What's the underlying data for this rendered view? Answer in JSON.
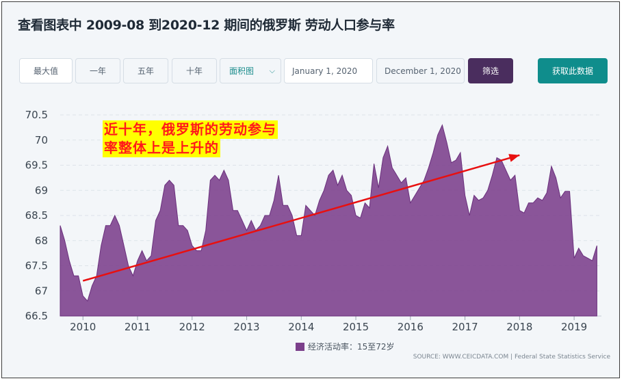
{
  "title": "查看图表中 2009-08 到2020-12 期间的俄罗斯 劳动人口参与率",
  "controls": {
    "max_label": "最大值",
    "one_year_label": "一年",
    "five_year_label": "五年",
    "ten_year_label": "十年",
    "chart_type_value": "面积图",
    "start_date": "January 1, 2020",
    "end_date": "December 1, 2020",
    "filter_label": "筛选",
    "get_data_label": "获取此数据"
  },
  "annotation": {
    "line1": "近十年，俄罗斯的劳动参与",
    "line2": "率整体上是上升的"
  },
  "source": "SOURCE: WWW.CEICDATA.COM | Federal State Statistics Service",
  "colors": {
    "area": "#7b3f8b",
    "trend": "#e81010",
    "filter_button": "#4a2d5e",
    "get_data_button": "#0f8d8c"
  },
  "chart_data": {
    "type": "area",
    "x_start": "2009-08",
    "x_end": "2019-07",
    "series": [
      {
        "name": "经济活动率：15至72岁",
        "values": [
          68.3,
          68.0,
          67.6,
          67.3,
          67.3,
          66.9,
          66.8,
          67.1,
          67.3,
          67.9,
          68.3,
          68.3,
          68.5,
          68.3,
          67.9,
          67.5,
          67.3,
          67.6,
          67.8,
          67.6,
          67.7,
          68.4,
          68.6,
          69.1,
          69.2,
          69.1,
          68.3,
          68.3,
          68.2,
          67.9,
          67.8,
          67.8,
          68.2,
          69.2,
          69.3,
          69.2,
          69.4,
          69.2,
          68.6,
          68.6,
          68.4,
          68.2,
          68.4,
          68.2,
          68.3,
          68.5,
          68.5,
          68.8,
          69.3,
          68.7,
          68.7,
          68.5,
          68.1,
          68.1,
          68.7,
          68.6,
          68.5,
          68.8,
          69.0,
          69.3,
          69.4,
          69.1,
          69.3,
          69.0,
          68.9,
          68.5,
          68.45,
          68.75,
          68.65,
          69.53,
          69.05,
          69.65,
          69.88,
          69.45,
          69.3,
          69.15,
          69.25,
          68.75,
          68.9,
          69.05,
          69.2,
          69.45,
          69.75,
          70.1,
          70.3,
          69.95,
          69.55,
          69.6,
          69.75,
          68.9,
          68.5,
          68.9,
          68.8,
          68.85,
          69.0,
          69.3,
          69.65,
          69.6,
          69.4,
          69.2,
          69.3,
          68.6,
          68.55,
          68.75,
          68.75,
          68.85,
          68.8,
          68.95,
          69.48,
          69.25,
          68.85,
          68.98,
          68.98,
          67.65,
          67.85,
          67.7,
          67.65,
          67.6,
          67.9
        ]
      }
    ],
    "x_tick_labels": [
      "2010",
      "2011",
      "2012",
      "2013",
      "2014",
      "2015",
      "2016",
      "2017",
      "2018",
      "2019"
    ],
    "y_tick_labels": [
      "66.5",
      "67",
      "67.5",
      "68",
      "68.5",
      "69",
      "69.5",
      "70",
      "70.5"
    ],
    "ylim": [
      66.5,
      70.5
    ],
    "grid": true,
    "legend_position": "bottom-center",
    "trend_line": {
      "x": [
        "2010-01",
        "2018-01"
      ],
      "y": [
        67.2,
        69.7
      ]
    }
  }
}
